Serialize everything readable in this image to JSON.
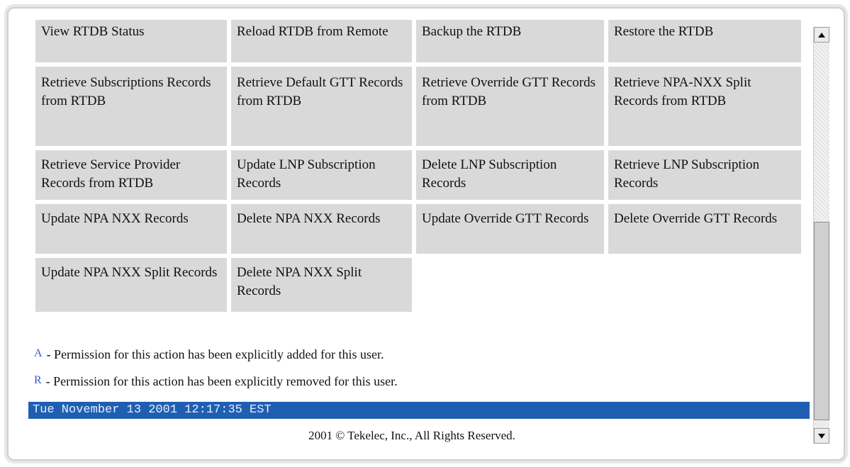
{
  "actions": [
    {
      "label": "View RTDB Status"
    },
    {
      "label": "Reload RTDB from Remote"
    },
    {
      "label": "Backup the RTDB"
    },
    {
      "label": "Restore the RTDB"
    },
    {
      "label": "Retrieve Subscriptions Records from RTDB"
    },
    {
      "label": "Retrieve Default GTT Records from RTDB"
    },
    {
      "label": "Retrieve Override GTT Records from RTDB"
    },
    {
      "label": "Retrieve NPA-NXX Split Records from RTDB"
    },
    {
      "label": "Retrieve Service Provider Records from RTDB"
    },
    {
      "label": "Update LNP Subscription Records"
    },
    {
      "label": "Delete LNP Subscription Records"
    },
    {
      "label": "Retrieve LNP Subscription Records"
    },
    {
      "label": "Update NPA NXX Records"
    },
    {
      "label": "Delete NPA NXX Records"
    },
    {
      "label": "Update Override GTT Records"
    },
    {
      "label": "Delete Override GTT Records"
    },
    {
      "label": "Update NPA NXX Split Records"
    },
    {
      "label": "Delete NPA NXX Split Records"
    }
  ],
  "legend": {
    "added_mark": "A",
    "added_text": "- Permission for this action has been explicitly added for this user.",
    "removed_mark": "R",
    "removed_text": "- Permission for this action has been explicitly removed for this user."
  },
  "status_bar": {
    "datetime": "Tue November 13 2001 12:17:35 EST"
  },
  "footer": {
    "copyright": "2001 © Tekelec, Inc., All Rights Reserved."
  },
  "colors": {
    "cell_background": "#d9d9d9",
    "date_bar": "#1f5fb2",
    "legend_mark": "#3a5bc7"
  },
  "icons": {
    "scroll_up": "scroll-up-arrow-icon",
    "scroll_down": "scroll-down-arrow-icon"
  }
}
